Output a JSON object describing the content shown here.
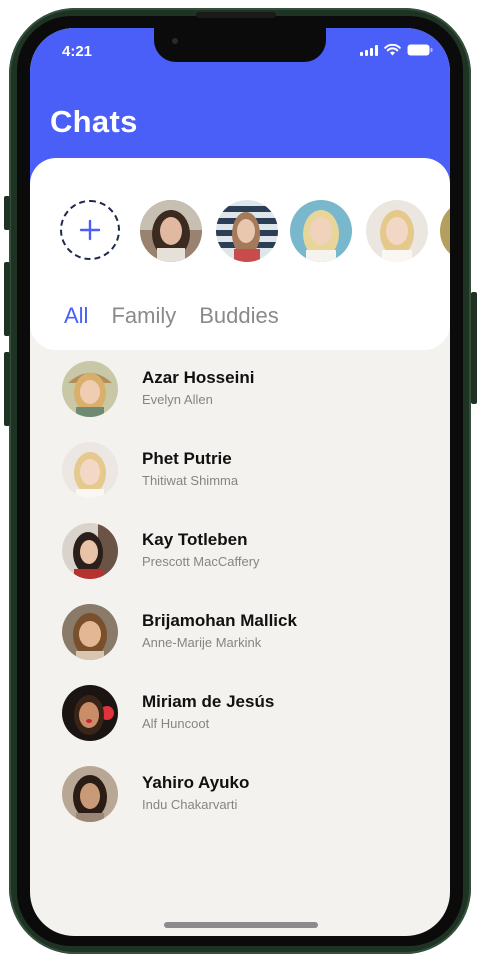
{
  "status_bar": {
    "time": "4:21"
  },
  "header": {
    "title": "Chats"
  },
  "stories": {
    "add_icon": "plus-icon",
    "items": [
      {
        "icon": "avatar-photo",
        "color": "#8a6b5a"
      },
      {
        "icon": "avatar-photo",
        "color": "#b7c4cc"
      },
      {
        "icon": "avatar-photo",
        "color": "#7bb9cc"
      },
      {
        "icon": "avatar-photo",
        "color": "#e9e1da"
      },
      {
        "icon": "avatar-photo",
        "color": "#a68f4d"
      }
    ]
  },
  "tabs": [
    {
      "label": "All",
      "active": true
    },
    {
      "label": "Family",
      "active": false
    },
    {
      "label": "Buddies",
      "active": false
    }
  ],
  "chats": [
    {
      "name": "Azar Hosseini",
      "subtitle": "Evelyn Allen"
    },
    {
      "name": "Phet Putrie",
      "subtitle": "Thitiwat Shimma"
    },
    {
      "name": "Kay Totleben",
      "subtitle": "Prescott MacCaffery"
    },
    {
      "name": "Brijamohan Mallick",
      "subtitle": "Anne-Marije Markink"
    },
    {
      "name": "Miriam de Jesús",
      "subtitle": "Alf Huncoot"
    },
    {
      "name": "Yahiro Ayuko",
      "subtitle": "Indu Chakarvarti"
    }
  ],
  "colors": {
    "accent": "#4a5ff7",
    "background": "#f3f2ef"
  }
}
